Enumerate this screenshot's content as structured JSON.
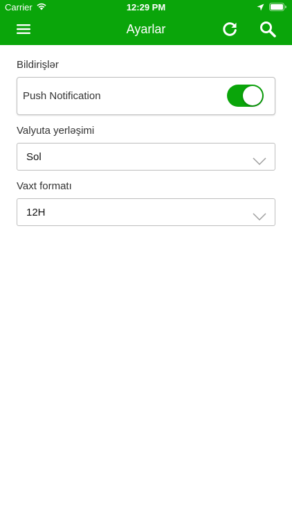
{
  "status_bar": {
    "carrier": "Carrier",
    "time": "12:29 PM"
  },
  "app_bar": {
    "title": "Ayarlar"
  },
  "notifications": {
    "section_label": "Bildirişlər",
    "push_label": "Push Notification",
    "push_enabled": true
  },
  "currency": {
    "section_label": "Valyuta yerləşimi",
    "selected": "Sol"
  },
  "time_format": {
    "section_label": "Vaxt formatı",
    "selected": "12H"
  },
  "colors": {
    "brand_green": "#0aa50a",
    "border": "#bdbdbd"
  },
  "icons": [
    "wifi-icon",
    "location-arrow-icon",
    "battery-icon",
    "menu-icon",
    "refresh-icon",
    "search-icon",
    "chevron-down-icon"
  ]
}
